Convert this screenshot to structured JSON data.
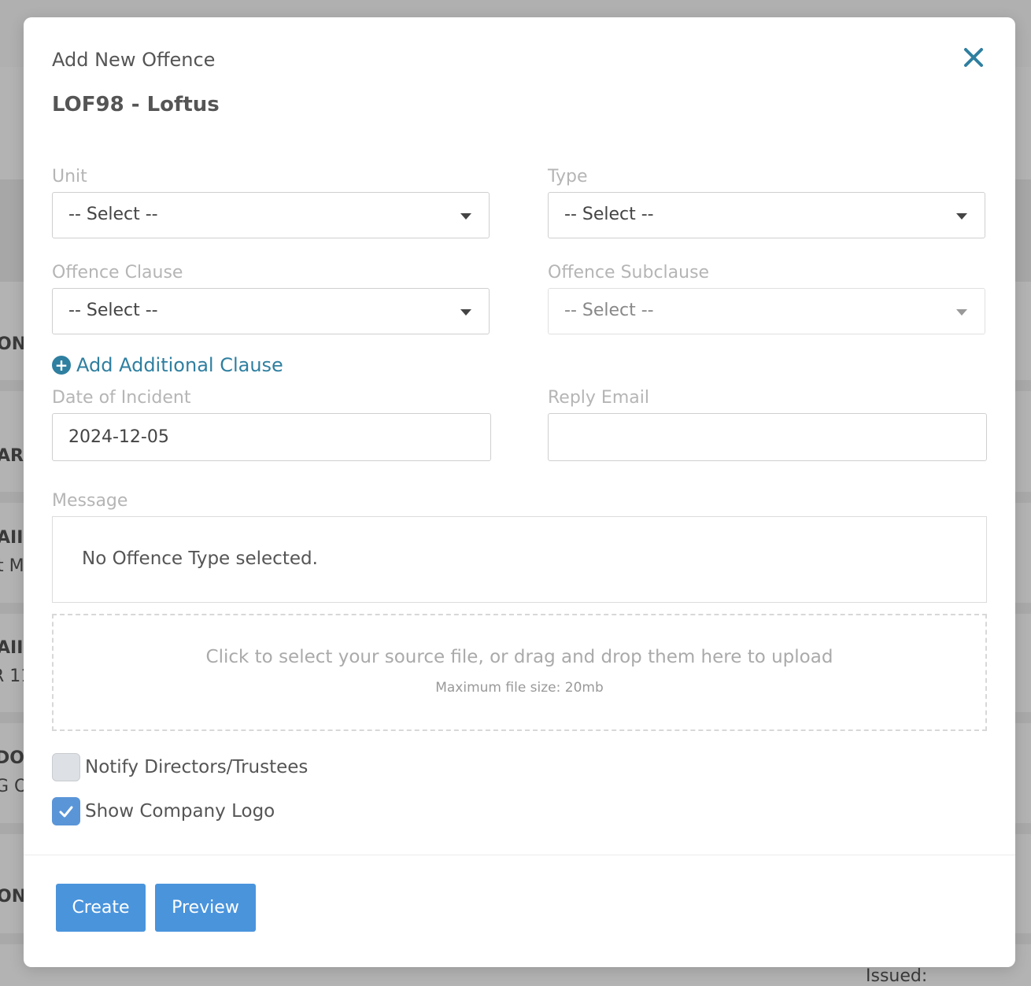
{
  "background": {
    "fragments": [
      "ON",
      "AR",
      "AII",
      "t M",
      "AII",
      "R 11",
      "DOL",
      "G O",
      "ON",
      "Issued:"
    ]
  },
  "modal": {
    "title": "Add New Offence",
    "subtitle": "LOF98 - Loftus",
    "close_icon": "close-icon"
  },
  "form": {
    "unit": {
      "label": "Unit",
      "value": "-- Select --"
    },
    "type": {
      "label": "Type",
      "value": "-- Select --"
    },
    "offence_clause": {
      "label": "Offence Clause",
      "value": "-- Select --"
    },
    "offence_subclause": {
      "label": "Offence Subclause",
      "value": "-- Select --"
    },
    "add_clause": {
      "label": "Add Additional Clause",
      "icon": "plus-circle-icon"
    },
    "date_of_incident": {
      "label": "Date of Incident",
      "value": "2024-12-05"
    },
    "reply_email": {
      "label": "Reply Email",
      "value": ""
    },
    "message": {
      "label": "Message",
      "text": "No Offence Type selected."
    },
    "upload": {
      "main": "Click to select your source file, or drag and drop them here to upload",
      "sub": "Maximum file size: 20mb"
    },
    "notify": {
      "label": "Notify Directors/Trustees",
      "checked": false
    },
    "show_logo": {
      "label": "Show Company Logo",
      "checked": true
    }
  },
  "actions": {
    "create": "Create",
    "preview": "Preview"
  },
  "colors": {
    "accent": "#2f7fa0",
    "button": "#4a94dc",
    "checkbox_checked": "#5a95d8"
  }
}
